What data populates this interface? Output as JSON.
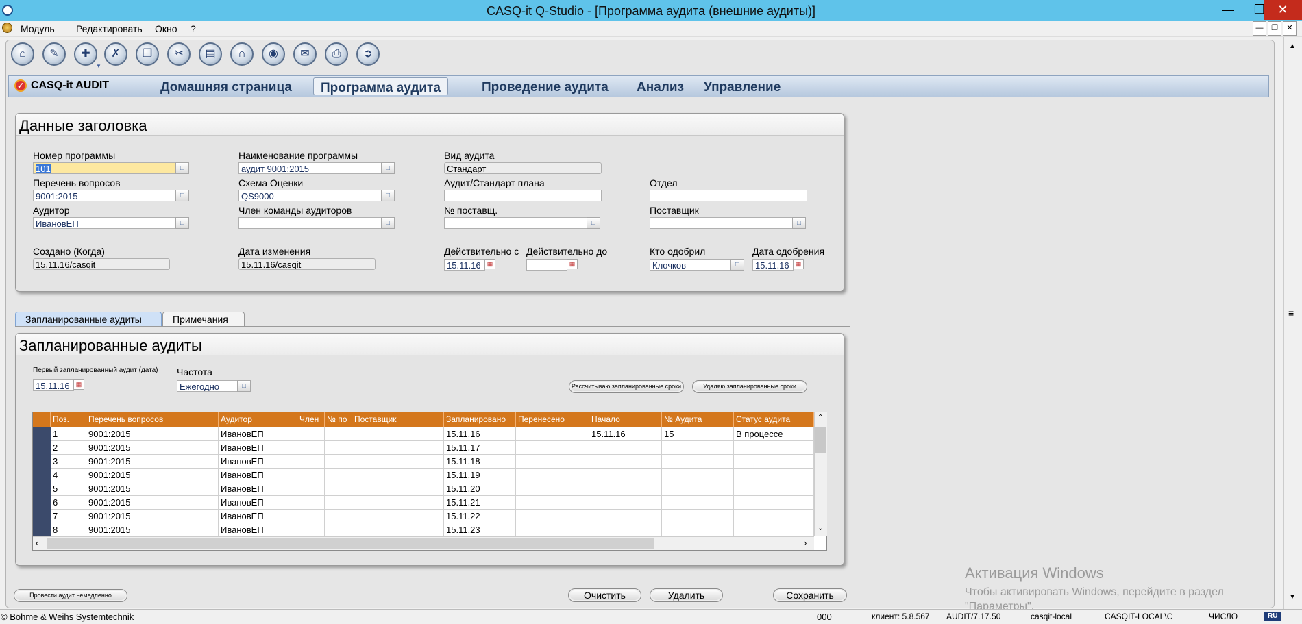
{
  "window": {
    "title": "CASQ-it Q-Studio - [Программа аудита (внешние аудиты)]"
  },
  "menu": {
    "items": [
      "Модуль",
      "Редактировать",
      "Окно",
      "?"
    ]
  },
  "nav": {
    "brand": "CASQ-it AUDIT",
    "tabs": [
      "Домашняя страница",
      "Программа аудита",
      "Проведение аудита",
      "Анализ",
      "Управление"
    ],
    "active": "Программа аудита"
  },
  "header": {
    "title": "Данные заголовка",
    "program_no_label": "Номер программы",
    "program_no": "101",
    "program_name_label": "Наименование программы",
    "program_name": "аудит 9001:2015",
    "audit_type_label": "Вид аудита",
    "audit_type": "Стандарт",
    "question_list_label": "Перечень вопросов",
    "question_list": "9001:2015",
    "scheme_label": "Схема Оценки",
    "scheme": "QS9000",
    "plan_std_label": "Аудит/Стандарт плана",
    "plan_std": "",
    "dept_label": "Отдел",
    "dept": "",
    "auditor_label": "Аудитор",
    "auditor": "ИвановЕП",
    "team_label": "Член команды аудиторов",
    "team": "",
    "supplier_no_label": "№ поставщ.",
    "supplier_no": "",
    "supplier_label": "Поставщик",
    "supplier": "",
    "created_label": "Создано (Когда)",
    "created": "15.11.16/casqit",
    "modified_label": "Дата изменения",
    "modified": "15.11.16/casqit",
    "valid_from_label": "Действительно с",
    "valid_from": "15.11.16",
    "valid_to_label": "Действительно до",
    "valid_to": "",
    "approved_by_label": "Кто одобрил",
    "approved_by": "Клочков",
    "approval_date_label": "Дата одобрения",
    "approval_date": "15.11.16"
  },
  "tabs": [
    "Запланированные аудиты",
    "Примечания"
  ],
  "planned": {
    "title": "Запланированные аудиты",
    "first_date_label": "Первый запланированный аудит (дата)",
    "first_date": "15.11.16",
    "freq_label": "Частота",
    "freq": "Ежегодно",
    "calc_button": "Рассчитываю запланированные сроки",
    "delete_button": "Удаляю запланированные сроки",
    "columns": [
      "Поз.",
      "Перечень вопросов",
      "Аудитор",
      "Член",
      "№ по",
      "Поставщик",
      "Запланировано",
      "Перенесено",
      "Начало",
      "№ Аудита",
      "Статус аудита"
    ],
    "rows": [
      [
        "1",
        "9001:2015",
        "ИвановЕП",
        "",
        "",
        "",
        "15.11.16",
        "",
        "15.11.16",
        "15",
        "В процессе"
      ],
      [
        "2",
        "9001:2015",
        "ИвановЕП",
        "",
        "",
        "",
        "15.11.17",
        "",
        "",
        "",
        ""
      ],
      [
        "3",
        "9001:2015",
        "ИвановЕП",
        "",
        "",
        "",
        "15.11.18",
        "",
        "",
        "",
        ""
      ],
      [
        "4",
        "9001:2015",
        "ИвановЕП",
        "",
        "",
        "",
        "15.11.19",
        "",
        "",
        "",
        ""
      ],
      [
        "5",
        "9001:2015",
        "ИвановЕП",
        "",
        "",
        "",
        "15.11.20",
        "",
        "",
        "",
        ""
      ],
      [
        "6",
        "9001:2015",
        "ИвановЕП",
        "",
        "",
        "",
        "15.11.21",
        "",
        "",
        "",
        ""
      ],
      [
        "7",
        "9001:2015",
        "ИвановЕП",
        "",
        "",
        "",
        "15.11.22",
        "",
        "",
        "",
        ""
      ],
      [
        "8",
        "9001:2015",
        "ИвановЕП",
        "",
        "",
        "",
        "15.11.23",
        "",
        "",
        "",
        ""
      ]
    ]
  },
  "footer": {
    "run_now": "Провести аудит немедленно",
    "clear": "Очистить",
    "delete": "Удалить",
    "save": "Сохранить"
  },
  "watermark": {
    "title": "Активация Windows",
    "line1": "Чтобы активировать Windows, перейдите в раздел",
    "line2": "\"Параметры\"."
  },
  "status": {
    "company": "© Böhme & Weihs Systemtechnik",
    "code": "000",
    "client": "клиент: 5.8.567",
    "audit": "AUDIT/7.17.50",
    "user": "casqit-local",
    "db": "CASQIT-LOCAL\\C",
    "num": "ЧИСЛО",
    "lang": "RU"
  }
}
